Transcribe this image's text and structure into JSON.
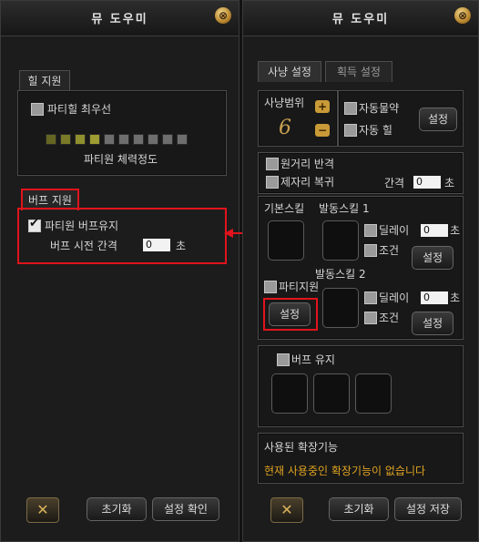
{
  "left": {
    "title": "뮤 도우미",
    "close": "⊗",
    "heal_tab": "힐 지원",
    "heal_priority_label": "파티힐 최우선",
    "hp_bar_colors": [
      "#666623",
      "#7a7a28",
      "#8f8f2d",
      "#9d9d33",
      "#6e6e6e",
      "#6e6e6e",
      "#6e6e6e",
      "#6e6e6e",
      "#6e6e6e",
      "#6e6e6e"
    ],
    "hp_label": "파티원 체력정도",
    "buff_tab": "버프 지원",
    "buff_keep_label": "파티원 버프유지",
    "buff_interval_label": "버프 시전 간격",
    "buff_interval_value": "0",
    "buff_interval_unit": "초",
    "reset_button": "초기화",
    "confirm_button": "설정 확인"
  },
  "right": {
    "title": "뮤 도우미",
    "close": "⊗",
    "tab_hunt": "사냥 설정",
    "tab_gain": "획득 설정",
    "range_label": "사냥범위",
    "range_value": "6",
    "auto_potion": "자동물약",
    "auto_heal": "자동 힐",
    "set_button": "설정",
    "counter_attack": "원거리 반격",
    "return_spot": "제자리 복귀",
    "interval_label": "간격",
    "interval_value": "0",
    "interval_unit": "초",
    "basic_skill": "기본스킬",
    "active_skill_1": "발동스킬 1",
    "active_skill_2": "발동스킬 2",
    "delay_label": "딜레이",
    "delay_value": "0",
    "delay_unit": "초",
    "condition_label": "조건",
    "party_label": "파티지원",
    "buff_keep": "버프 유지",
    "ext_title": "사용된 확장기능",
    "ext_message": "현재 사용중인 확장기능이 없습니다",
    "reset_button": "초기화",
    "save_button": "설정 저장"
  },
  "colors": {
    "highlight": "#e0141c",
    "gold_text": "#e0a321"
  }
}
